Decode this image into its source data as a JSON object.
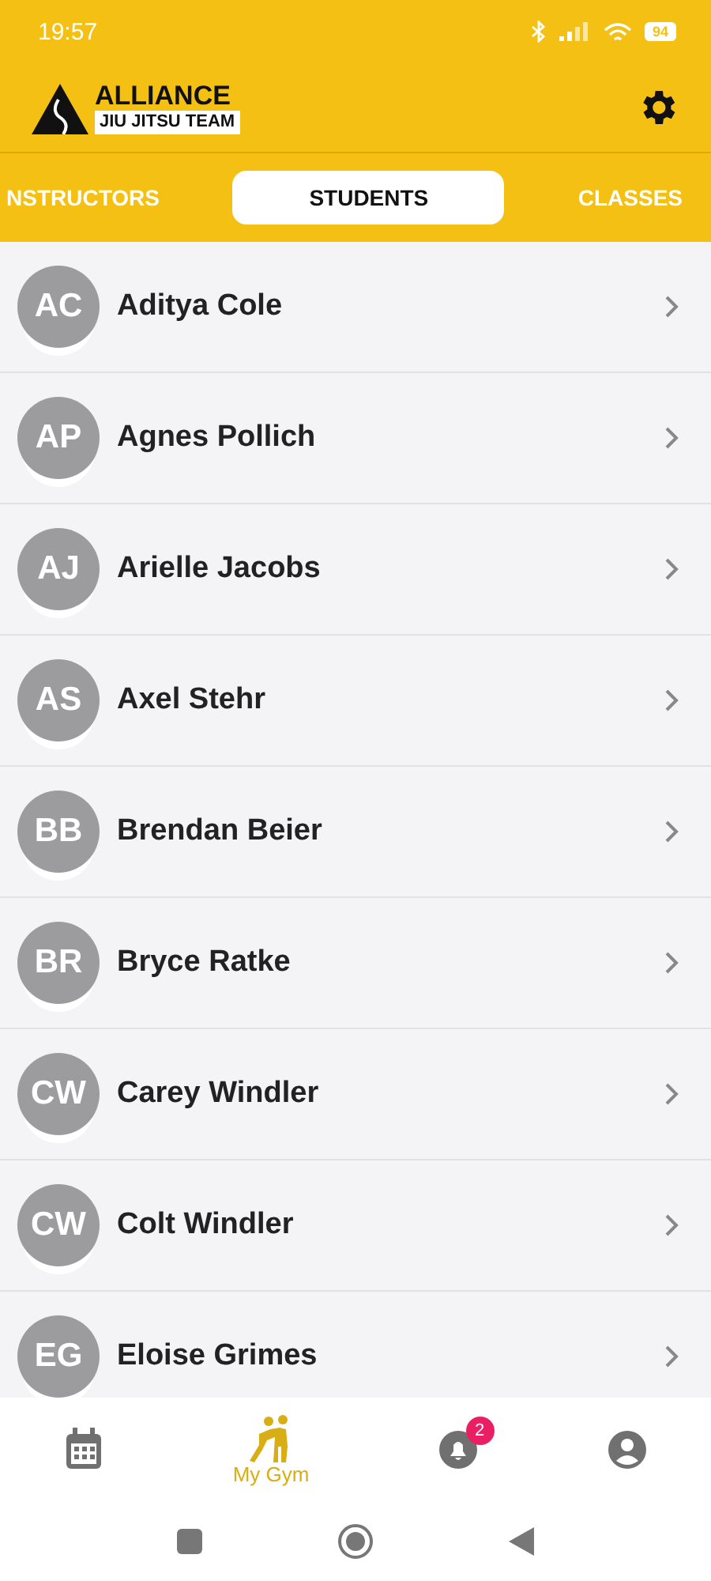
{
  "status_bar": {
    "time": "19:57",
    "battery": "94"
  },
  "header": {
    "logo": {
      "line1": "ALLIANCE",
      "line2": "JIU JITSU TEAM"
    }
  },
  "tabs": [
    {
      "label": "NSTRUCTORS",
      "selected": false
    },
    {
      "label": "STUDENTS",
      "selected": true
    },
    {
      "label": "CLASSES",
      "selected": false
    }
  ],
  "students": [
    {
      "initials": "AC",
      "name": "Aditya Cole"
    },
    {
      "initials": "AP",
      "name": "Agnes Pollich"
    },
    {
      "initials": "AJ",
      "name": "Arielle Jacobs"
    },
    {
      "initials": "AS",
      "name": "Axel Stehr"
    },
    {
      "initials": "BB",
      "name": "Brendan Beier"
    },
    {
      "initials": "BR",
      "name": "Bryce Ratke"
    },
    {
      "initials": "CW",
      "name": "Carey Windler"
    },
    {
      "initials": "CW",
      "name": "Colt Windler"
    },
    {
      "initials": "EG",
      "name": "Eloise Grimes"
    }
  ],
  "bottom_nav": [
    {
      "kind": "calendar",
      "selected": false
    },
    {
      "kind": "gym",
      "label": "My Gym",
      "selected": true
    },
    {
      "kind": "notifications",
      "badge": "2",
      "selected": false
    },
    {
      "kind": "profile",
      "selected": false
    }
  ]
}
